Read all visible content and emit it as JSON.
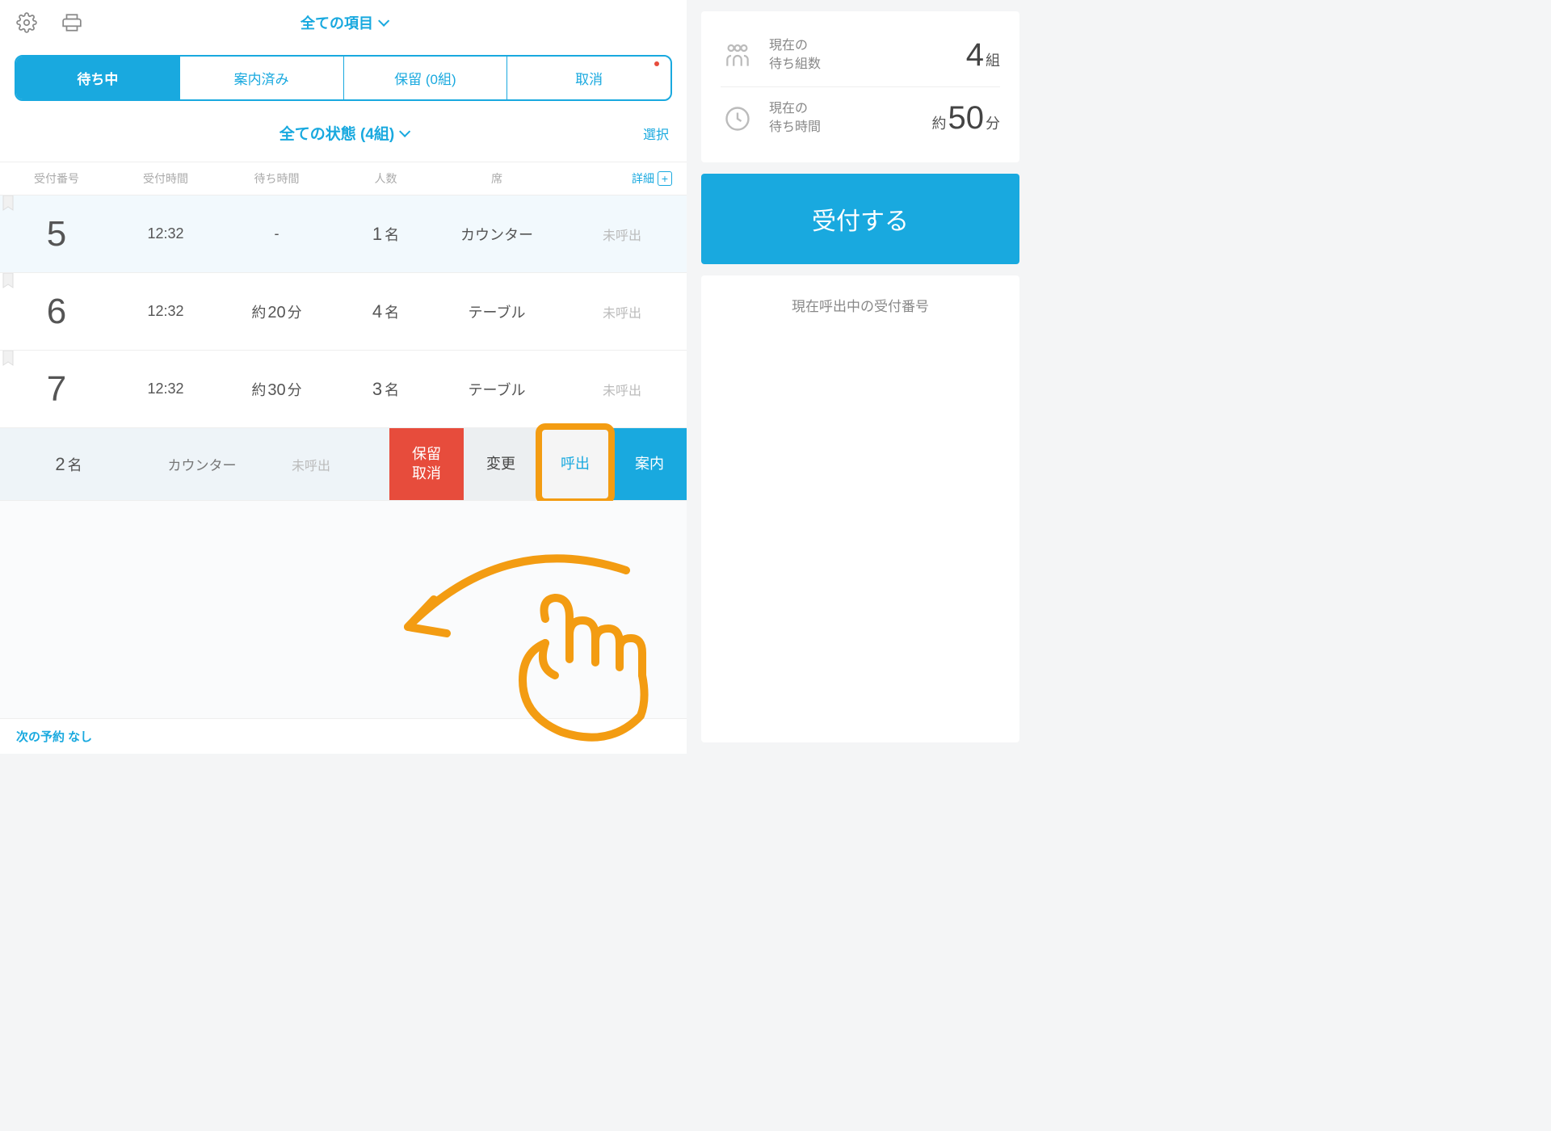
{
  "header": {
    "dropdown": "全ての項目"
  },
  "tabs": [
    {
      "label": "待ち中",
      "active": true
    },
    {
      "label": "案内済み",
      "active": false
    },
    {
      "label": "保留 (0組)",
      "active": false
    },
    {
      "label": "取消",
      "active": false,
      "dot": true
    }
  ],
  "filter": {
    "label": "全ての状態 (4組)",
    "select": "選択"
  },
  "columns": {
    "num": "受付番号",
    "time": "受付時間",
    "wait": "待ち時間",
    "people": "人数",
    "seat": "席",
    "detail": "詳細"
  },
  "rows": [
    {
      "num": "5",
      "time": "12:32",
      "wait": "-",
      "people": "1",
      "people_unit": "名",
      "seat": "カウンター",
      "status": "未呼出",
      "highlight": true
    },
    {
      "num": "6",
      "time": "12:32",
      "wait_prefix": "約",
      "wait_num": "20",
      "wait_unit": "分",
      "people": "4",
      "people_unit": "名",
      "seat": "テーブル",
      "status": "未呼出",
      "highlight": false
    },
    {
      "num": "7",
      "time": "12:32",
      "wait_prefix": "約",
      "wait_num": "30",
      "wait_unit": "分",
      "people": "3",
      "people_unit": "名",
      "seat": "テーブル",
      "status": "未呼出",
      "highlight": false
    }
  ],
  "action_row": {
    "people": "2",
    "people_unit": "名",
    "seat": "カウンター",
    "status": "未呼出",
    "btn_hold_cancel": "保留\n取消",
    "btn_change": "変更",
    "btn_call": "呼出",
    "btn_guide": "案内"
  },
  "footer": {
    "next": "次の予約 なし"
  },
  "side": {
    "count_label1": "現在の",
    "count_label2": "待ち組数",
    "count_num": "4",
    "count_unit": "組",
    "wait_label1": "現在の",
    "wait_label2": "待ち時間",
    "wait_prefix": "約",
    "wait_num": "50",
    "wait_unit": "分",
    "reception_btn": "受付する",
    "calling_title": "現在呼出中の受付番号"
  }
}
